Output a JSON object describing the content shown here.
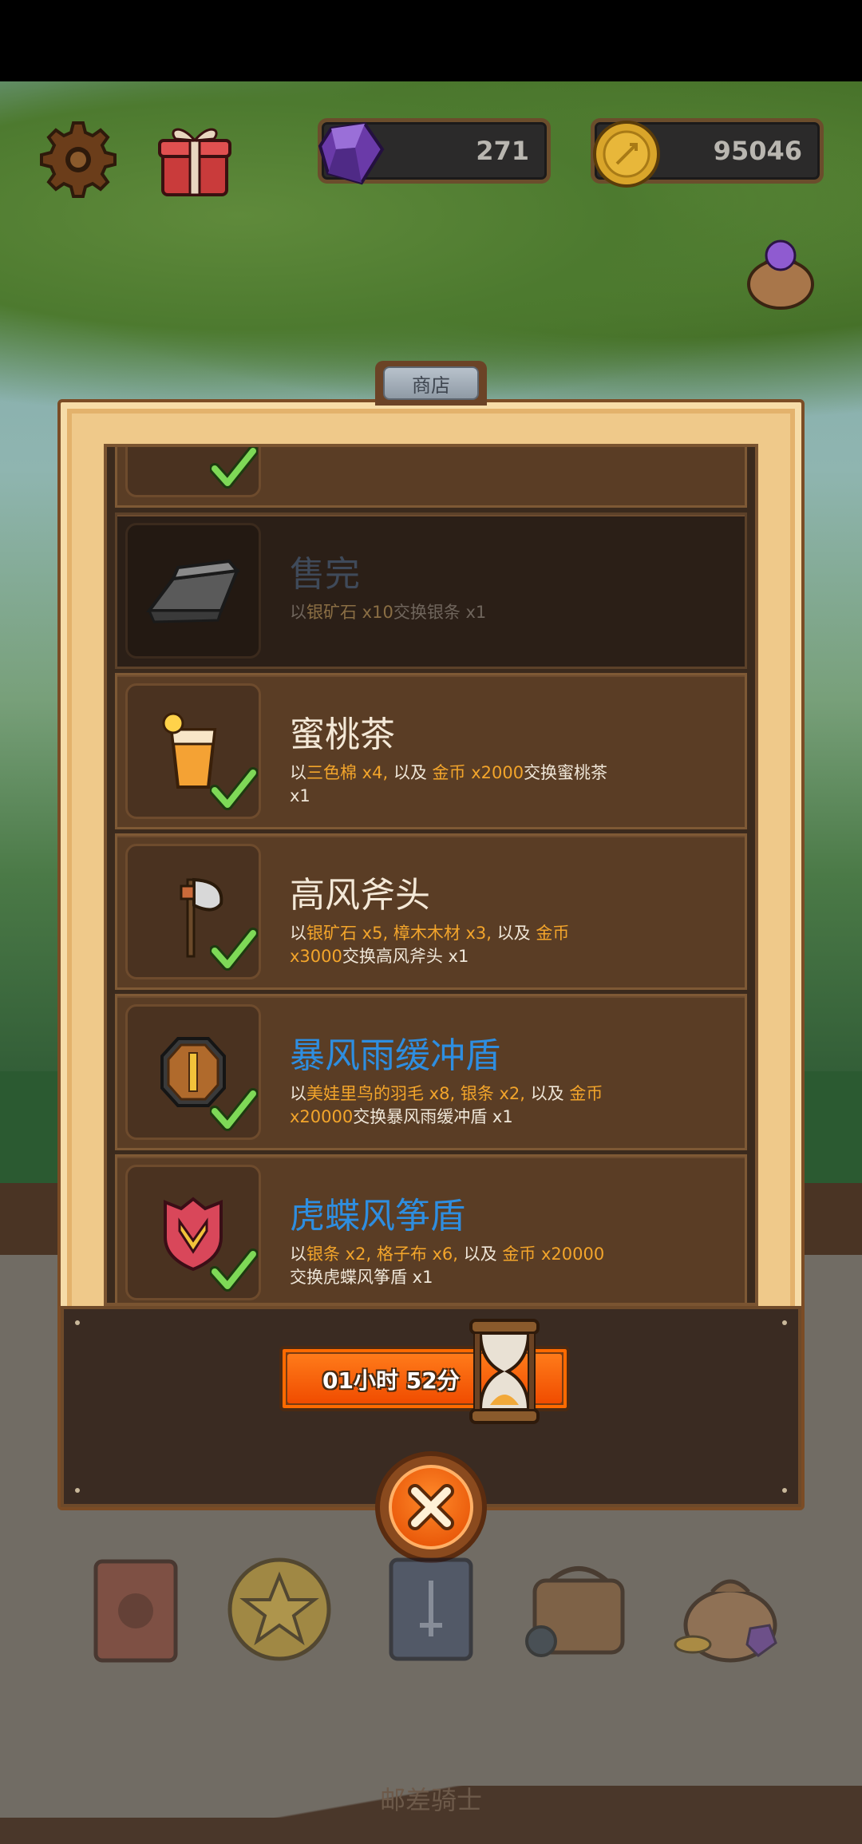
{
  "hud": {
    "gems": "271",
    "gold": "95046"
  },
  "shop": {
    "tab_label": "商店",
    "items": [
      {
        "title": "售完",
        "desc_parts": [
          "以",
          "银矿石 x10",
          "交换银条 x1"
        ],
        "sold_out": true,
        "icon": "silver-bar-icon"
      },
      {
        "title": "蜜桃茶",
        "desc_parts": [
          "以",
          "三色棉 x4, ",
          "以及 ",
          "金币 x2000",
          "交换蜜桃茶 x1"
        ],
        "icon": "peach-tea-icon"
      },
      {
        "title": "高风斧头",
        "desc_parts": [
          "以",
          "银矿石 x5, 樟木木材 x3, ",
          "以及 ",
          "金币 x3000",
          "交换高风斧头 x1"
        ],
        "icon": "axe-icon"
      },
      {
        "title": "暴风雨缓冲盾",
        "desc_parts": [
          "以",
          "美娃里鸟的羽毛 x8, 银条 x2, ",
          "以及 ",
          "金币 x20000",
          "交换暴风雨缓冲盾 x1"
        ],
        "icon": "wooden-shield-icon",
        "rare": true
      },
      {
        "title": "虎蝶风筝盾",
        "desc_parts": [
          "以",
          "银条 x2, 格子布 x6, ",
          "以及 ",
          "金币 x20000",
          "交换虎蝶风筝盾 x1"
        ],
        "icon": "kite-shield-icon",
        "rare": true
      }
    ]
  },
  "timer": {
    "hours": "01",
    "hours_unit": "小时",
    "minutes": "52",
    "minutes_unit": "分"
  },
  "footer": {
    "title": "邮差骑士"
  },
  "colors": {
    "highlight": "#f3a52b",
    "rare_title": "#2e8ee0",
    "modal_parchment": "#efc98a",
    "row_bg": "#5a3d25"
  }
}
